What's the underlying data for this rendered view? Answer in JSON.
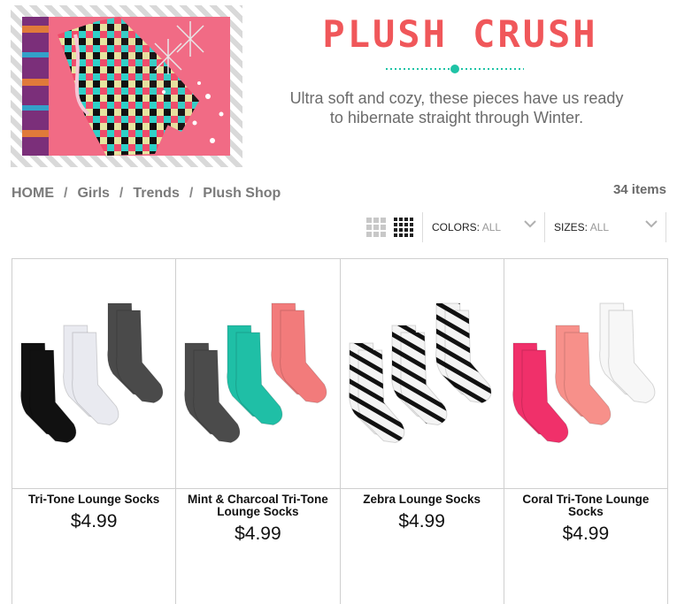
{
  "banner": {
    "title": "PLUSH CRUSH",
    "description_line1": "Ultra soft and cozy, these pieces have us ready",
    "description_line2": "to hibernate straight through Winter.",
    "accent_color": "#f0575a",
    "divider_color": "#1fc3a6"
  },
  "breadcrumb": {
    "items": [
      "HOME",
      "Girls",
      "Trends",
      "Plush Shop"
    ],
    "separator": "/"
  },
  "results": {
    "count_label": "34 items"
  },
  "toolbar": {
    "colors_label": "COLORS:",
    "colors_value": "ALL",
    "sizes_label": "SIZES:",
    "sizes_value": "ALL"
  },
  "products": [
    {
      "name": "Tri-Tone Lounge Socks",
      "price": "$4.99",
      "sock_colors": [
        "#111111",
        "#e9eaf0",
        "#4a4a4a"
      ]
    },
    {
      "name": "Mint & Charcoal Tri-Tone Lounge Socks",
      "price": "$4.99",
      "sock_colors": [
        "#4b4b4b",
        "#1fbfa6",
        "#f27b7b"
      ]
    },
    {
      "name": "Zebra Lounge Socks",
      "price": "$4.99",
      "sock_colors": [
        "#f2f2f2",
        "#f2f2f2",
        "#f2f2f2"
      ]
    },
    {
      "name": "Coral Tri-Tone Lounge Socks",
      "price": "$4.99",
      "sock_colors": [
        "#f0306a",
        "#f7908a",
        "#f7f7f7"
      ]
    }
  ]
}
